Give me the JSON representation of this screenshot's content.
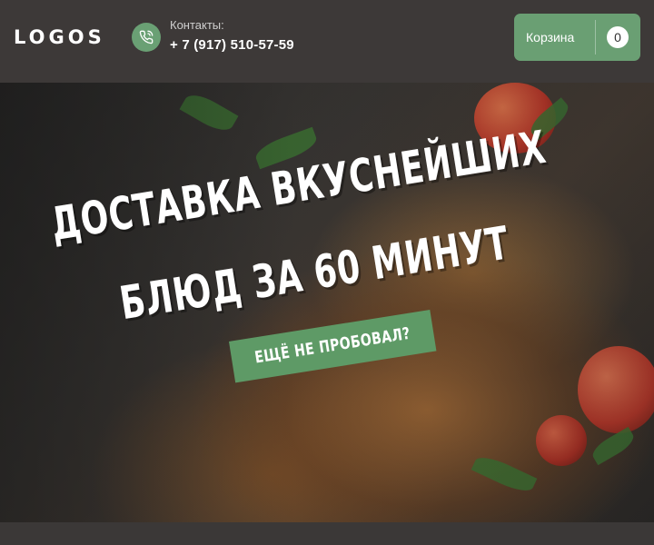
{
  "header": {
    "logo": "LOGOS",
    "contacts_label": "Контакты:",
    "phone": "+ 7 (917) 510-57-59",
    "phone_icon": "phone-icon",
    "cart_label": "Корзина",
    "cart_count": "0"
  },
  "hero": {
    "line1": "ДОСТАВКА ВКУСНЕЙШИХ",
    "line2": "БЛЮД ЗА 60 МИНУТ",
    "cta": "ЕЩЁ НЕ ПРОБОВАЛ?"
  },
  "colors": {
    "accent_green": "#6a9f73",
    "header_bg": "#3d3938",
    "text_white": "#ffffff"
  }
}
